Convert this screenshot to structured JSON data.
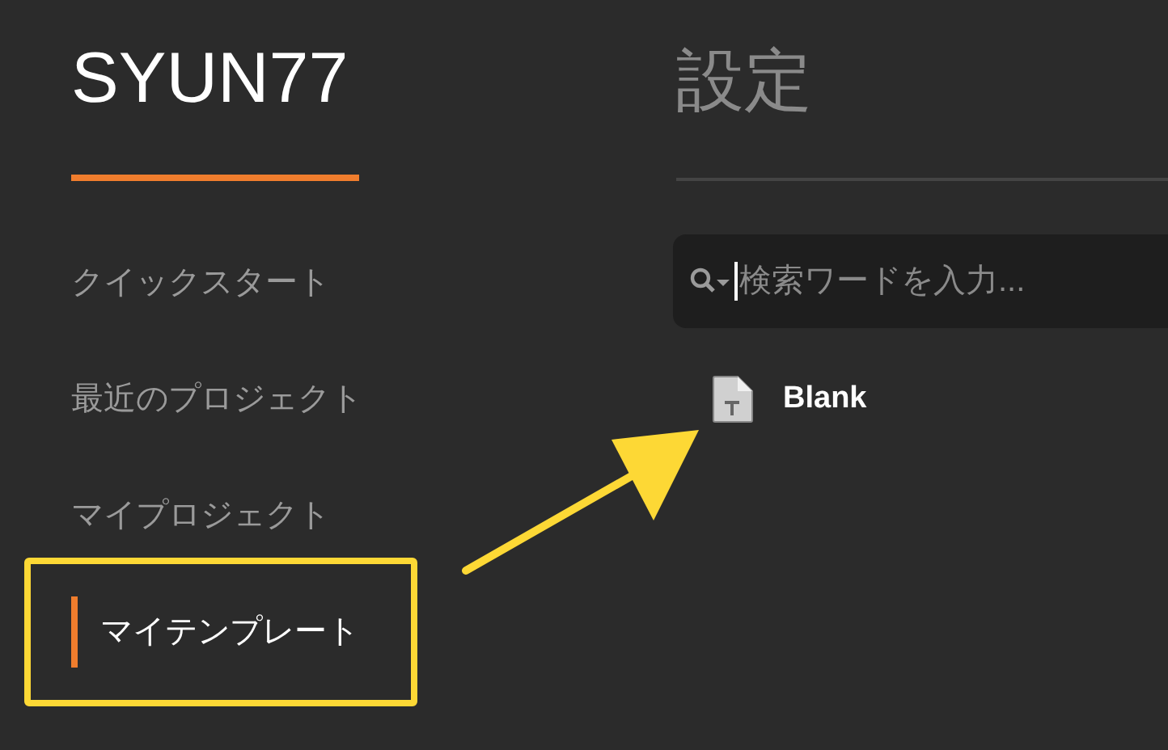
{
  "header": {
    "user": "SYUN77",
    "title": "設定"
  },
  "sidebar": {
    "items": [
      {
        "label": "クイックスタート",
        "selected": false
      },
      {
        "label": "最近のプロジェクト",
        "selected": false
      },
      {
        "label": "マイプロジェクト",
        "selected": false
      },
      {
        "label": "マイテンプレート",
        "selected": true
      }
    ]
  },
  "search": {
    "placeholder": "検索ワードを入力..."
  },
  "templates": [
    {
      "label": "Blank"
    }
  ]
}
